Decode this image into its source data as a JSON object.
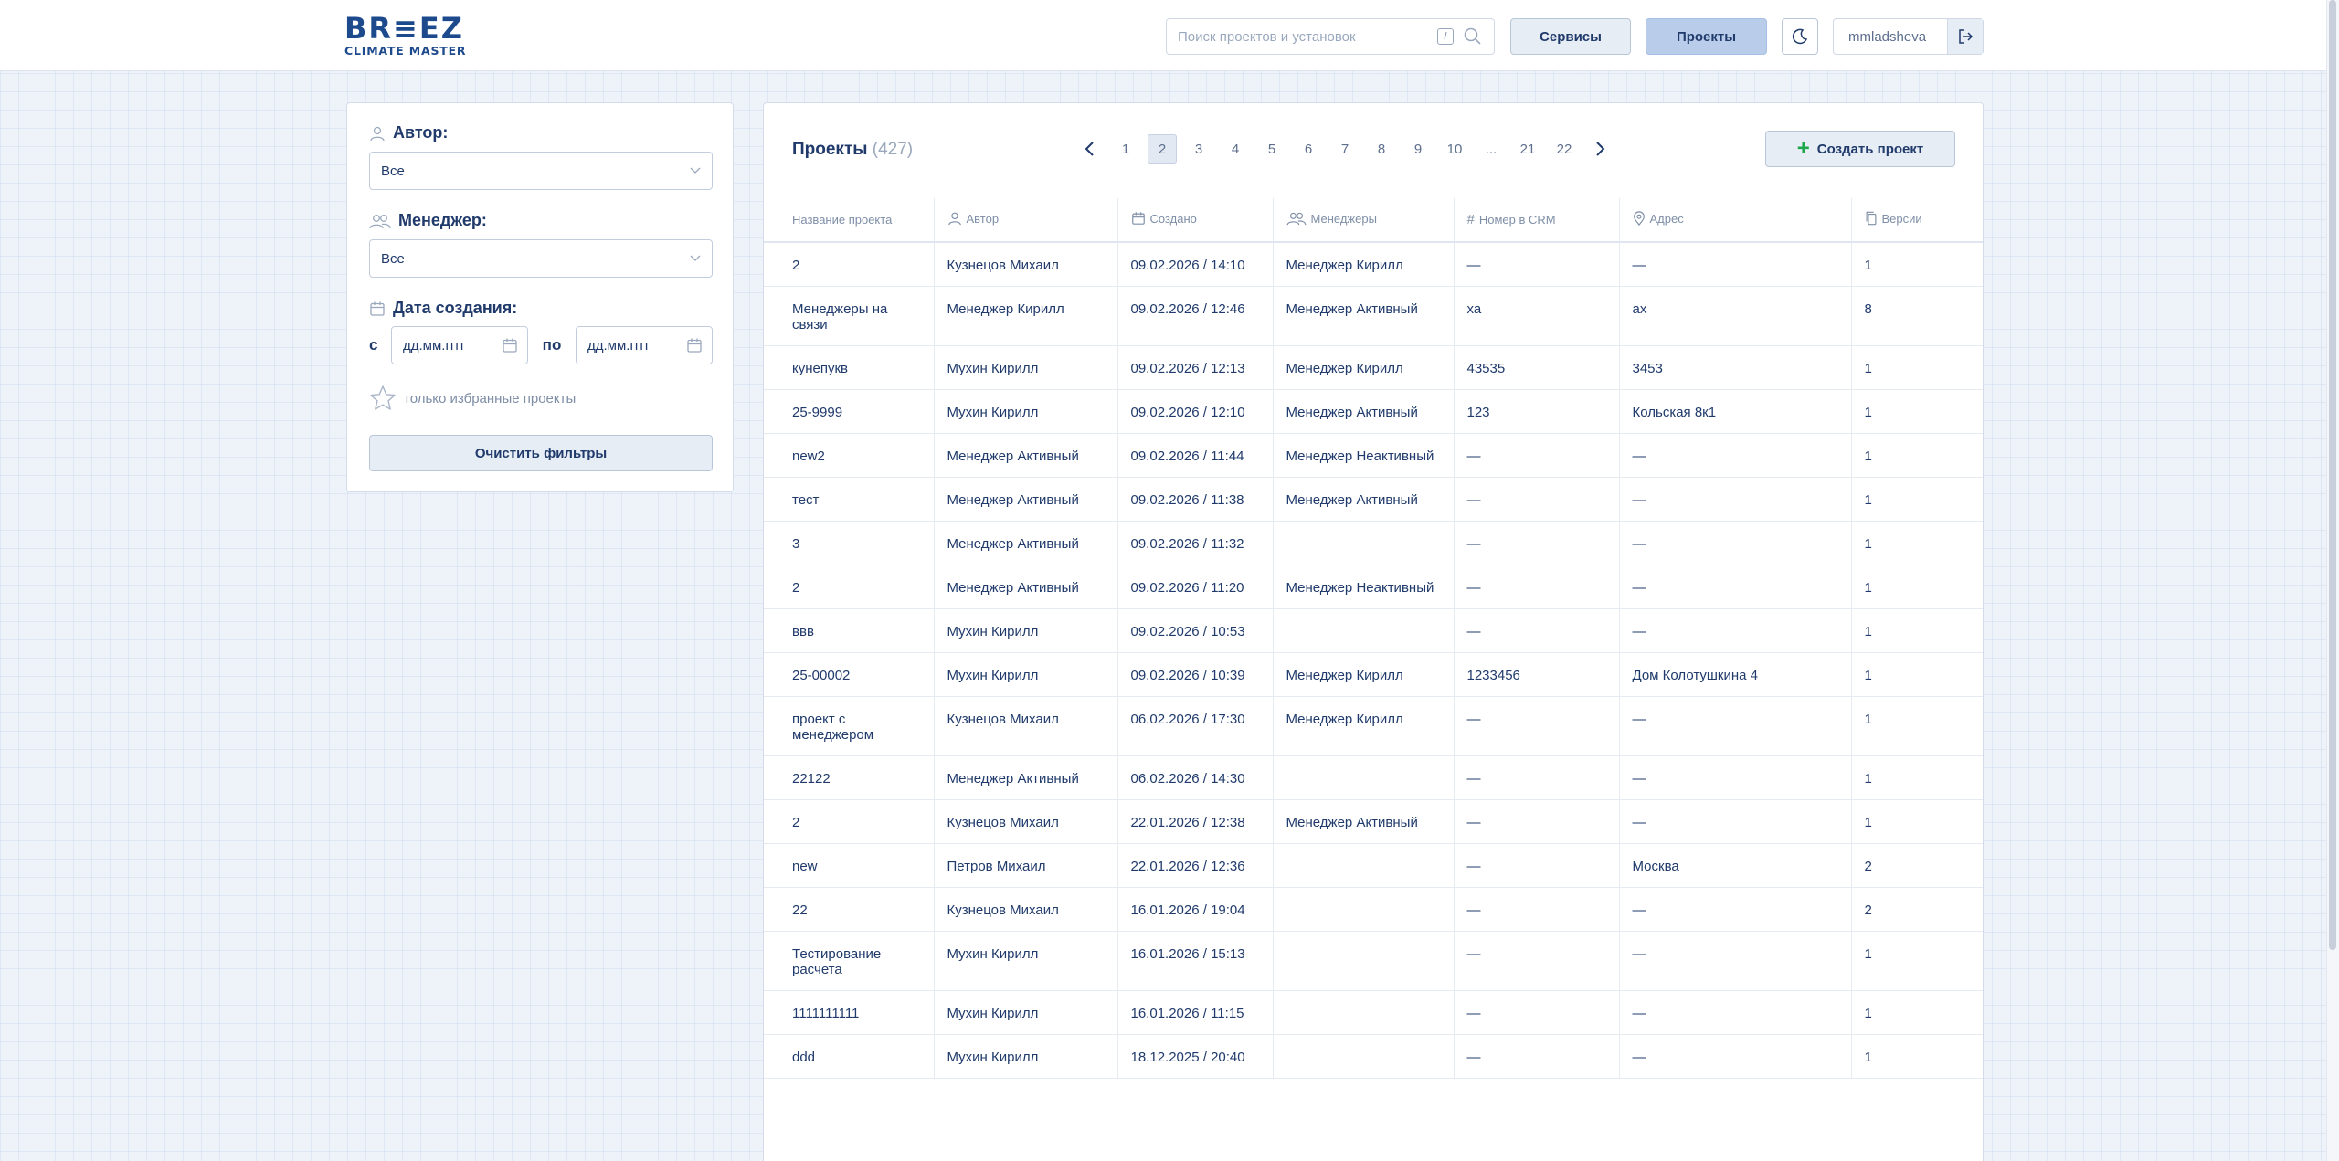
{
  "header": {
    "logo_top": "BR≡EZ",
    "logo_bottom": "CLIMATE MASTER",
    "search_placeholder": "Поиск проектов и установок",
    "search_shortcut": "/",
    "services_label": "Сервисы",
    "projects_label": "Проекты",
    "username": "mmladsheva"
  },
  "filters": {
    "author_label": "Автор:",
    "author_value": "Все",
    "manager_label": "Менеджер:",
    "manager_value": "Все",
    "date_label": "Дата создания:",
    "date_from_prefix": "с",
    "date_from_value": "дд.мм.гггг",
    "date_to_prefix": "по",
    "date_to_value": "дд.мм.гггг",
    "favorites_label": "только избранные проекты",
    "clear_label": "Очистить фильтры"
  },
  "main": {
    "title": "Проекты",
    "count": "(427)",
    "create_label": "Создать проект",
    "pages": [
      "1",
      "2",
      "3",
      "4",
      "5",
      "6",
      "7",
      "8",
      "9",
      "10",
      "...",
      "21",
      "22"
    ],
    "active_page": "2",
    "columns": {
      "name": "Название проекта",
      "author": "Автор",
      "created": "Создано",
      "managers": "Менеджеры",
      "crm": "Номер в CRM",
      "address": "Адрес",
      "versions": "Версии"
    },
    "rows": [
      [
        "2",
        "Кузнецов Михаил",
        "09.02.2026 / 14:10",
        "Менеджер Кирилл",
        "—",
        "—",
        "1"
      ],
      [
        "Менеджеры на связи",
        "Менеджер Кирилл",
        "09.02.2026 / 12:46",
        "Менеджер Активный",
        "ха",
        "ах",
        "8"
      ],
      [
        "кунепукв",
        "Мухин Кирилл",
        "09.02.2026 / 12:13",
        "Менеджер Кирилл",
        "43535",
        "3453",
        "1"
      ],
      [
        "25-9999",
        "Мухин Кирилл",
        "09.02.2026 / 12:10",
        "Менеджер Активный",
        "123",
        "Кольская 8к1",
        "1"
      ],
      [
        "new2",
        "Менеджер Активный",
        "09.02.2026 / 11:44",
        "Менеджер Неактивный",
        "—",
        "—",
        "1"
      ],
      [
        "тест",
        "Менеджер Активный",
        "09.02.2026 / 11:38",
        "Менеджер Активный",
        "—",
        "—",
        "1"
      ],
      [
        "3",
        "Менеджер Активный",
        "09.02.2026 / 11:32",
        "",
        "—",
        "—",
        "1"
      ],
      [
        "2",
        "Менеджер Активный",
        "09.02.2026 / 11:20",
        "Менеджер Неактивный",
        "—",
        "—",
        "1"
      ],
      [
        "ввв",
        "Мухин Кирилл",
        "09.02.2026 / 10:53",
        "",
        "—",
        "—",
        "1"
      ],
      [
        "25-00002",
        "Мухин Кирилл",
        "09.02.2026 / 10:39",
        "Менеджер Кирилл",
        "1233456",
        "Дом Колотушкина 4",
        "1"
      ],
      [
        "проект с менеджером",
        "Кузнецов Михаил",
        "06.02.2026 / 17:30",
        "Менеджер Кирилл",
        "—",
        "—",
        "1"
      ],
      [
        "22122",
        "Менеджер Активный",
        "06.02.2026 / 14:30",
        "",
        "—",
        "—",
        "1"
      ],
      [
        "2",
        "Кузнецов Михаил",
        "22.01.2026 / 12:38",
        "Менеджер Активный",
        "—",
        "—",
        "1"
      ],
      [
        "new",
        "Петров Михаил",
        "22.01.2026 / 12:36",
        "",
        "—",
        "Москва",
        "2"
      ],
      [
        "22",
        "Кузнецов Михаил",
        "16.01.2026 / 19:04",
        "",
        "—",
        "—",
        "2"
      ],
      [
        "Тестирование расчета",
        "Мухин Кирилл",
        "16.01.2026 / 15:13",
        "",
        "—",
        "—",
        "1"
      ],
      [
        "1111111111",
        "Мухин Кирилл",
        "16.01.2026 / 11:15",
        "",
        "—",
        "—",
        "1"
      ],
      [
        "ddd",
        "Мухин Кирилл",
        "18.12.2025 / 20:40",
        "",
        "—",
        "—",
        "1"
      ]
    ]
  },
  "colors": {
    "brand": "#1d4a8d",
    "text": "#1f3a6b",
    "muted": "#7e8ea7",
    "active_button": "#b9cdea",
    "plus": "#1fa84a"
  }
}
